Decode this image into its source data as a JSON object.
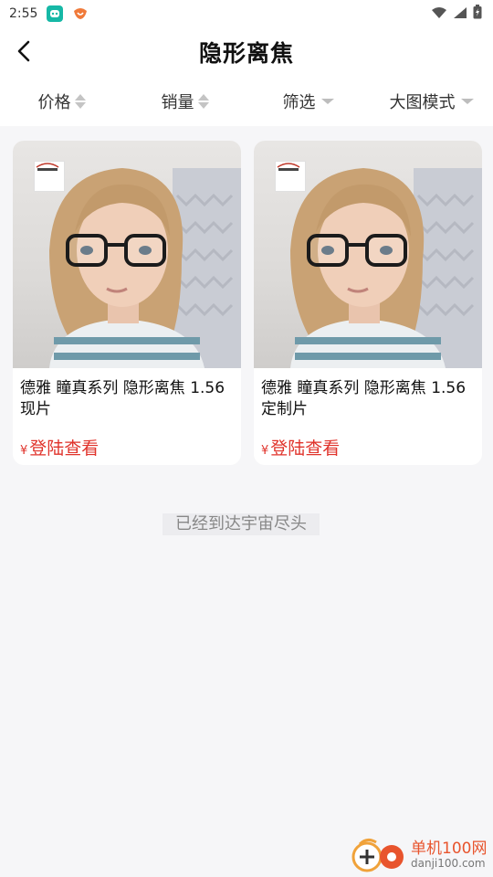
{
  "status_bar": {
    "time": "2:55"
  },
  "nav": {
    "title": "隐形离焦"
  },
  "filters": [
    {
      "label": "价格",
      "indicator": "sort"
    },
    {
      "label": "销量",
      "indicator": "sort"
    },
    {
      "label": "筛选",
      "indicator": "dropdown"
    },
    {
      "label": "大图模式",
      "indicator": "dropdown"
    }
  ],
  "products": [
    {
      "name": "德雅 瞳真系列 隐形离焦 1.56 现片",
      "currency": "¥",
      "price_text": "登陆查看"
    },
    {
      "name": "德雅 瞳真系列 隐形离焦 1.56 定制片",
      "currency": "¥",
      "price_text": "登陆查看"
    }
  ],
  "end_note": "已经到达宇宙尽头",
  "watermark": {
    "line1": "单机100网",
    "line2": "danji100.com"
  },
  "colors": {
    "price": "#e0332b",
    "accent": "#e8542d",
    "background": "#f6f6f8"
  }
}
